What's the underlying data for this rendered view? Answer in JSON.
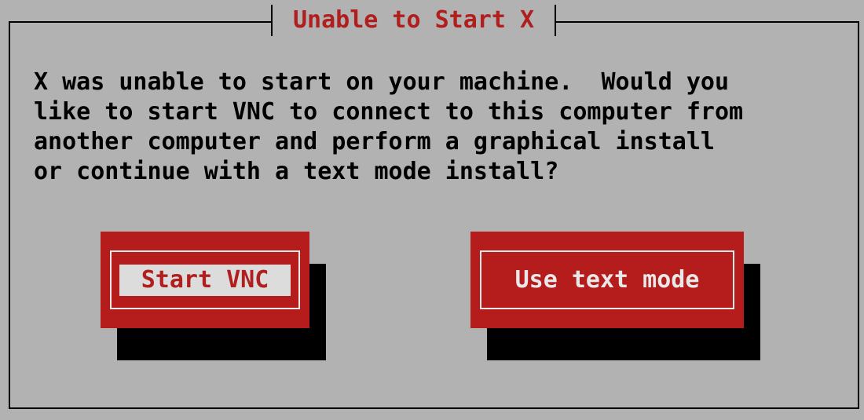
{
  "dialog": {
    "title": "Unable to Start X",
    "message": "X was unable to start on your machine.  Would you\nlike to start VNC to connect to this computer from\nanother computer and perform a graphical install\nor continue with a text mode install?"
  },
  "buttons": {
    "start_vnc_label": "Start VNC",
    "text_mode_label": "Use text mode"
  },
  "colors": {
    "background": "#b2b2b2",
    "button_red": "#b51c1c",
    "title_red": "#b01e1e",
    "focus_fill": "#dcdcdc",
    "shadow": "#000000"
  }
}
